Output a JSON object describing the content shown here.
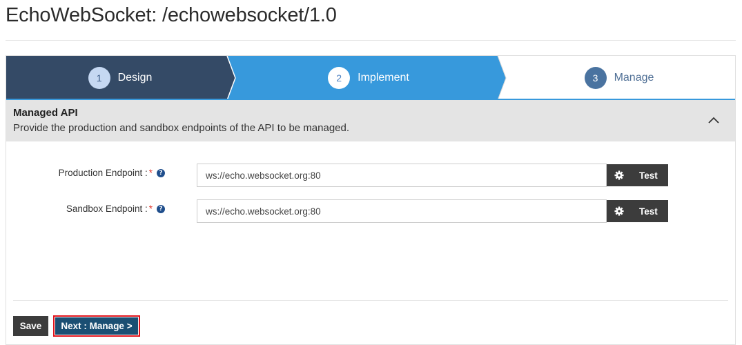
{
  "header": {
    "title": "EchoWebSocket: /echowebsocket/1.0"
  },
  "wizard": {
    "steps": [
      {
        "number": "1",
        "label": "Design",
        "state": "completed",
        "color": "#344a66"
      },
      {
        "number": "2",
        "label": "Implement",
        "state": "active",
        "color": "#3799dc"
      },
      {
        "number": "3",
        "label": "Manage",
        "state": "pending",
        "color": "#ffffff"
      }
    ]
  },
  "section": {
    "title": "Managed API",
    "description": "Provide the production and sandbox endpoints of the API to be managed.",
    "collapse_icon": "chevron-up-icon"
  },
  "form": {
    "production": {
      "label": "Production Endpoint :",
      "required_mark": "*",
      "help_icon": "help-circle-icon",
      "value": "ws://echo.websocket.org:80",
      "test_label": "Test",
      "test_icon": "gear-icon"
    },
    "sandbox": {
      "label": "Sandbox Endpoint :",
      "required_mark": "*",
      "help_icon": "help-circle-icon",
      "value": "ws://echo.websocket.org:80",
      "test_label": "Test",
      "test_icon": "gear-icon"
    }
  },
  "actions": {
    "save_label": "Save",
    "next_label": "Next : Manage >",
    "next_highlight_color": "#e0141c"
  }
}
